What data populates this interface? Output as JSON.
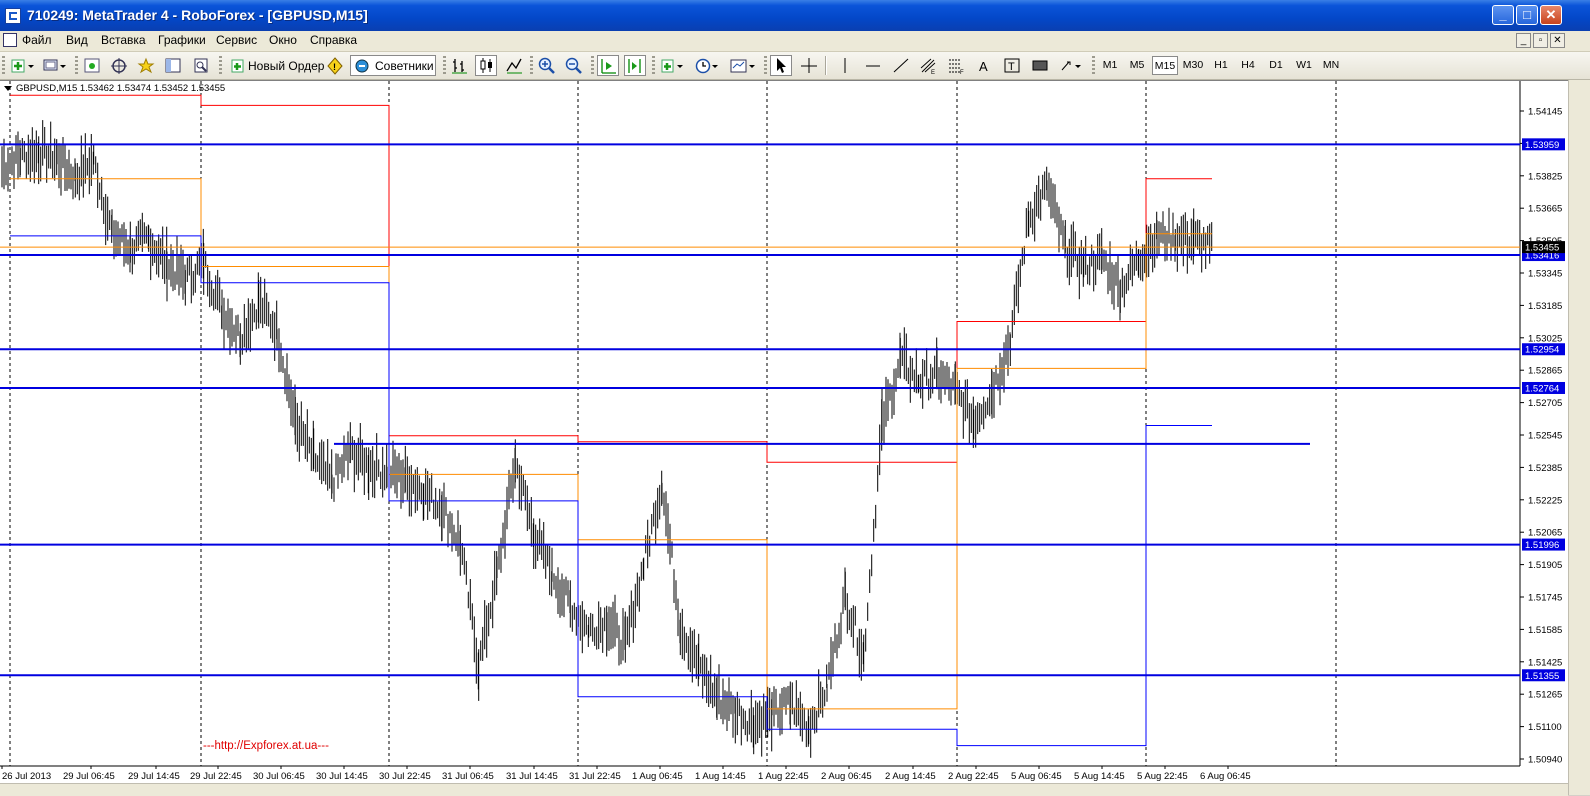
{
  "window": {
    "title": "710249: MetaTrader 4 - RoboForex - [GBPUSD,M15]",
    "minimize_glyph": "_",
    "maximize_glyph": "□",
    "close_glyph": "✕"
  },
  "menu": {
    "items": [
      "Файл",
      "Вид",
      "Вставка",
      "Графики",
      "Сервис",
      "Окно",
      "Справка"
    ],
    "mdi": [
      "_",
      "▫",
      "✕"
    ]
  },
  "toolbar": {
    "new_order_label": "Новый Ордер",
    "experts_label": "Советники",
    "timeframes": [
      "M1",
      "M5",
      "M15",
      "M30",
      "H1",
      "H4",
      "D1",
      "W1",
      "MN"
    ],
    "active_timeframe": "M15",
    "badge": "4"
  },
  "chart": {
    "symbol_info": "GBPUSD,M15  1.53462 1.53474 1.53452 1.53455",
    "watermark": "---http://Expforex.at.ua---",
    "colors": {
      "candles": "#000000",
      "level_lines": "#0000e0",
      "red_line": "#ff0000",
      "orange_line": "#ff8c00",
      "thin_blue": "#0000ff",
      "price_box": "#0000e0",
      "current_price_box": "#ff8c00"
    }
  },
  "chart_data": {
    "type": "line",
    "price_axis_ticks": [
      "1.54145",
      "1.53985",
      "1.53825",
      "1.53665",
      "1.53505",
      "1.53345",
      "1.53185",
      "1.53025",
      "1.52865",
      "1.52705",
      "1.52545",
      "1.52385",
      "1.52225",
      "1.52065",
      "1.51905",
      "1.51745",
      "1.51585",
      "1.51425",
      "1.51265",
      "1.51100",
      "1.50940"
    ],
    "time_axis_ticks": [
      "26 Jul 2013",
      "29 Jul 06:45",
      "29 Jul 14:45",
      "29 Jul 22:45",
      "30 Jul 06:45",
      "30 Jul 14:45",
      "30 Jul 22:45",
      "31 Jul 06:45",
      "31 Jul 14:45",
      "31 Jul 22:45",
      "1 Aug 06:45",
      "1 Aug 14:45",
      "1 Aug 22:45",
      "2 Aug 06:45",
      "2 Aug 14:45",
      "2 Aug 22:45",
      "5 Aug 06:45",
      "5 Aug 14:45",
      "5 Aug 22:45",
      "6 Aug 06:45"
    ],
    "ylim": [
      1.5091,
      1.5425
    ],
    "horizontal_levels": [
      {
        "value": 1.53959,
        "label": "1.53959"
      },
      {
        "value": 1.53416,
        "label": "1.53416"
      },
      {
        "value": 1.52954,
        "label": "1.52954"
      },
      {
        "value": 1.52764,
        "label": "1.52764"
      },
      {
        "value": 1.51996,
        "label": "1.51996"
      },
      {
        "value": 1.51355,
        "label": "1.51355"
      }
    ],
    "current_price": {
      "value": 1.53455,
      "label": "1.53455"
    },
    "partial_level": {
      "value": 1.5249
    },
    "day_separators": [
      "26 Jul",
      "29 Jul",
      "30 Jul",
      "31 Jul",
      "1 Aug",
      "2 Aug",
      "5 Aug",
      "6 Aug"
    ],
    "daily_high_red": [
      1.542,
      1.5415,
      1.5253,
      1.525,
      1.524,
      1.5309,
      1.5379
    ],
    "daily_mid_orange": [
      1.5379,
      1.5336,
      1.5234,
      1.5202,
      1.5119,
      1.5286,
      1.5352
    ],
    "daily_low_blue": [
      1.5351,
      1.5328,
      1.5221,
      1.5125,
      1.5109,
      1.5101,
      1.5258
    ],
    "price_path": [
      1.5385,
      1.539,
      1.5392,
      1.5389,
      1.538,
      1.5388,
      1.5352,
      1.5345,
      1.5349,
      1.5337,
      1.533,
      1.5338,
      1.5315,
      1.5302,
      1.5318,
      1.5305,
      1.526,
      1.5242,
      1.523,
      1.5245,
      1.5238,
      1.5236,
      1.5232,
      1.5226,
      1.5218,
      1.52,
      1.514,
      1.5185,
      1.524,
      1.5205,
      1.5185,
      1.517,
      1.5158,
      1.5162,
      1.515,
      1.519,
      1.523,
      1.516,
      1.514,
      1.5125,
      1.5118,
      1.5112,
      1.5116,
      1.5122,
      1.511,
      1.513,
      1.5175,
      1.5145,
      1.5258,
      1.529,
      1.528,
      1.5283,
      1.5275,
      1.526,
      1.5275,
      1.53,
      1.536,
      1.5375,
      1.5345,
      1.5336,
      1.534,
      1.5325,
      1.534,
      1.5351,
      1.535,
      1.5349,
      1.5345
    ]
  }
}
